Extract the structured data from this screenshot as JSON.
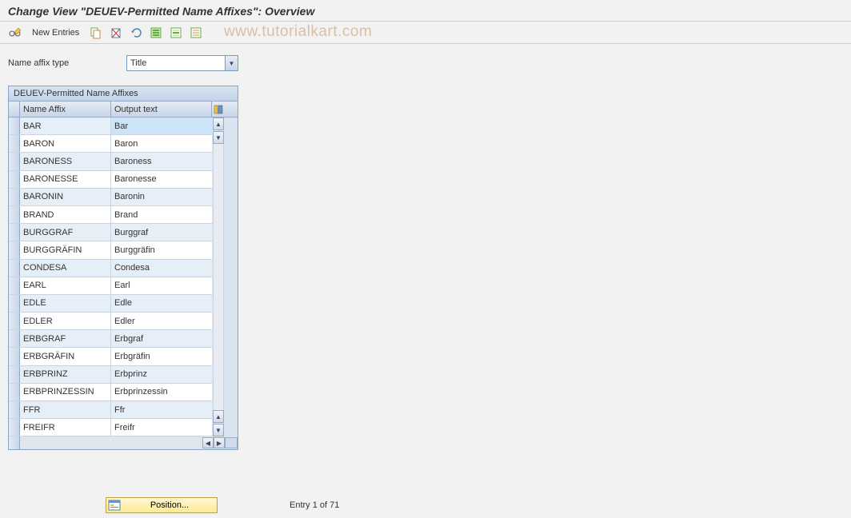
{
  "title": "Change View \"DEUEV-Permitted Name Affixes\": Overview",
  "toolbar": {
    "new_entries_label": "New Entries"
  },
  "watermark": "www.tutorialkart.com",
  "filter": {
    "label": "Name affix type",
    "value": "Title"
  },
  "table": {
    "title": "DEUEV-Permitted Name Affixes",
    "columns": {
      "affix": "Name Affix",
      "output": "Output text"
    },
    "rows": [
      {
        "affix": "BAR",
        "output": "Bar"
      },
      {
        "affix": "BARON",
        "output": "Baron"
      },
      {
        "affix": "BARONESS",
        "output": "Baroness"
      },
      {
        "affix": "BARONESSE",
        "output": "Baronesse"
      },
      {
        "affix": "BARONIN",
        "output": "Baronin"
      },
      {
        "affix": "BRAND",
        "output": "Brand"
      },
      {
        "affix": "BURGGRAF",
        "output": "Burggraf"
      },
      {
        "affix": "BURGGRÄFIN",
        "output": "Burggräfin"
      },
      {
        "affix": "CONDESA",
        "output": "Condesa"
      },
      {
        "affix": "EARL",
        "output": "Earl"
      },
      {
        "affix": "EDLE",
        "output": "Edle"
      },
      {
        "affix": "EDLER",
        "output": "Edler"
      },
      {
        "affix": "ERBGRAF",
        "output": "Erbgraf"
      },
      {
        "affix": "ERBGRÄFIN",
        "output": "Erbgräfin"
      },
      {
        "affix": "ERBPRINZ",
        "output": "Erbprinz"
      },
      {
        "affix": "ERBPRINZESSIN",
        "output": "Erbprinzessin"
      },
      {
        "affix": "FFR",
        "output": "Ffr"
      },
      {
        "affix": "FREIFR",
        "output": "Freifr"
      }
    ]
  },
  "footer": {
    "position_label": "Position...",
    "entry_info": "Entry 1 of 71"
  }
}
